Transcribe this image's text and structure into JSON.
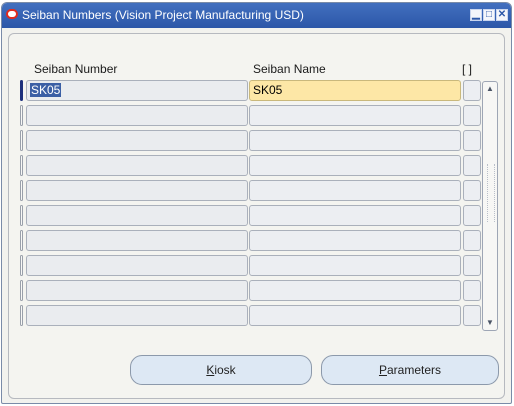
{
  "window": {
    "title": "Seiban Numbers (Vision Project Manufacturing USD)",
    "title_bar_color": "#3563b4",
    "controls": [
      "minimize",
      "maximize",
      "close"
    ]
  },
  "table": {
    "columns": {
      "number": "Seiban Number",
      "name": "Seiban Name",
      "extra": "[ ]"
    },
    "rows": [
      {
        "number": "SK05",
        "name": "SK05",
        "active": true
      },
      {
        "number": "",
        "name": ""
      },
      {
        "number": "",
        "name": ""
      },
      {
        "number": "",
        "name": ""
      },
      {
        "number": "",
        "name": ""
      },
      {
        "number": "",
        "name": ""
      },
      {
        "number": "",
        "name": ""
      },
      {
        "number": "",
        "name": ""
      },
      {
        "number": "",
        "name": ""
      },
      {
        "number": "",
        "name": ""
      }
    ],
    "active_cell_color": "#fde7a6"
  },
  "buttons": {
    "kiosk": {
      "label_mnemonic": "K",
      "label_rest": "iosk"
    },
    "parameters": {
      "label_mnemonic": "P",
      "label_rest": "arameters"
    }
  }
}
